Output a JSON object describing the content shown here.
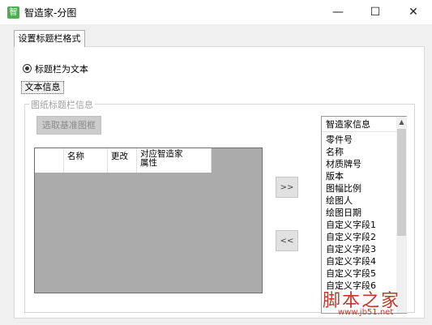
{
  "window": {
    "title": "智造家-分图",
    "app_icon_glyph": "智",
    "controls": {
      "minimize": "—",
      "maximize": "☐",
      "close": "✕"
    }
  },
  "tabs": [
    {
      "label": "设置标题栏格式",
      "active": true
    }
  ],
  "radio": {
    "label": "标题栏为文本",
    "checked": true
  },
  "text_info_label": "文本信息",
  "group": {
    "label": "图纸标题栏信息",
    "select_frame_button": "选取基准图框"
  },
  "grid": {
    "columns": [
      "",
      "名称",
      "更改",
      "对应智造家\n属性"
    ]
  },
  "move_buttons": {
    "add": ">>",
    "remove": "<<"
  },
  "attribute_list": {
    "header": "智造家信息",
    "items": [
      "零件号",
      "名称",
      "材质牌号",
      "版本",
      "图幅比例",
      "绘图人",
      "绘图日期",
      "自定义字段1",
      "自定义字段2",
      "自定义字段3",
      "自定义字段4",
      "自定义字段5",
      "自定义字段6"
    ]
  },
  "watermark": {
    "text": "脚本之家",
    "url": "www.jb51.net"
  },
  "colors": {
    "dialog_bg": "#f0f0f0",
    "grid_bg": "#ababab",
    "app_icon": "#4caf50",
    "watermark": "#c0392b"
  }
}
